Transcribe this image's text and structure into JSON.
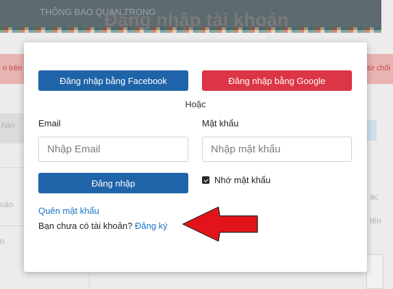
{
  "page": {
    "title": "Đăng nhập tài khoản",
    "background_banner_text": "THÔNG BÁO QUAN TRỌNG",
    "background_red_left": "n trên",
    "background_red_right": "từ chối",
    "background_frag_1": "hàn",
    "background_frag_2": "ác",
    "background_frag_3": "cáo",
    "background_frag_4": "n",
    "background_frag_5": "tên"
  },
  "login_modal": {
    "facebook_button": "Đăng nhập bằng Facebook",
    "google_button": "Đăng nhập bằng Google",
    "separator": "Hoặc",
    "email_label": "Email",
    "email_placeholder": "Nhập Email",
    "password_label": "Mật khẩu",
    "password_placeholder": "Nhập mật khẩu",
    "login_button": "Đăng nhập",
    "remember_label": "Nhớ mật khẩu",
    "remember_checked": true,
    "forgot_link": "Quên mật khẩu",
    "signup_prompt": "Bạn chưa có tài khoản?",
    "signup_link": "Đăng ký"
  },
  "colors": {
    "facebook": "#1f63a8",
    "google": "#dc3545",
    "link": "#1a73c9",
    "annotation_arrow": "#e3131b"
  },
  "icons": {
    "annotation": "red-left-arrow"
  }
}
